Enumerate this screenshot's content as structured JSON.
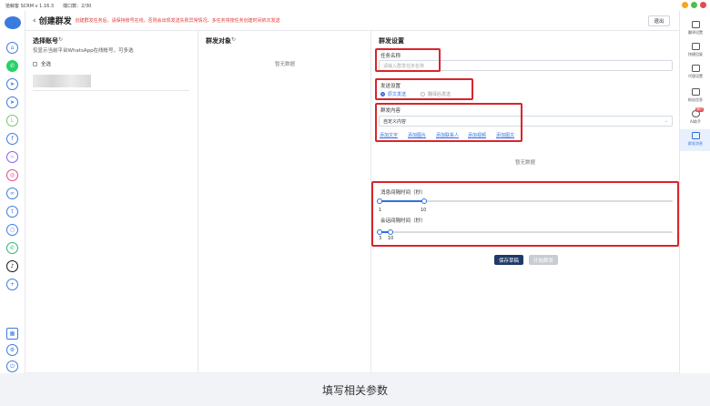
{
  "titlebar": {
    "app": "拾鲸客 SCRM v 1.16.3",
    "ports": "端口数：2/30"
  },
  "header": {
    "title": "创建群发",
    "warning": "创建群发任务后，请保持账号在线，否则会出现发送失败异常情况，多任务将按任务创建时间依次发送",
    "exit_label": "退出"
  },
  "accounts": {
    "title": "选择账号",
    "subtitle": "仅显示当前平台WhatsApp在线帐号，可多选",
    "select_all": "全选"
  },
  "targets": {
    "title": "群发对象",
    "empty": "暂无数据"
  },
  "settings": {
    "title": "群发设置",
    "task_name_label": "任务名称",
    "task_name_placeholder": "请输入群发任务名称",
    "send_settings_label": "发送设置",
    "send_option_1": "原文发送",
    "send_option_2": "翻译后发送",
    "content_label": "群发内容",
    "content_select": "自定义内容",
    "add_links": [
      "添加文字",
      "添加图片",
      "添加联系人",
      "添加视频",
      "添加图文"
    ],
    "content_empty": "暂无数据",
    "msg_interval_label": "消息间隔时间（秒）",
    "msg_interval": {
      "min": 1,
      "max": 10
    },
    "session_interval_label": "会话间隔时间（秒）",
    "session_interval": {
      "min": 3,
      "max": 10
    },
    "save_draft": "保存草稿",
    "start_send": "开始群发"
  },
  "right_rail": [
    {
      "label": "翻译设置",
      "icon": "translate-icon"
    },
    {
      "label": "快捷回复",
      "icon": "quick-reply-icon"
    },
    {
      "label": "代理设置",
      "icon": "proxy-icon"
    },
    {
      "label": "粉丝信息",
      "icon": "fans-icon"
    },
    {
      "label": "AI助手",
      "icon": "ai-icon",
      "badge": "限时"
    },
    {
      "label": "群发消息",
      "icon": "broadcast-icon"
    }
  ],
  "caption": "填写相关参数",
  "colors": {
    "accent": "#2f6fe0",
    "annotation": "#d9252a",
    "primary_button": "#1f3a68"
  }
}
